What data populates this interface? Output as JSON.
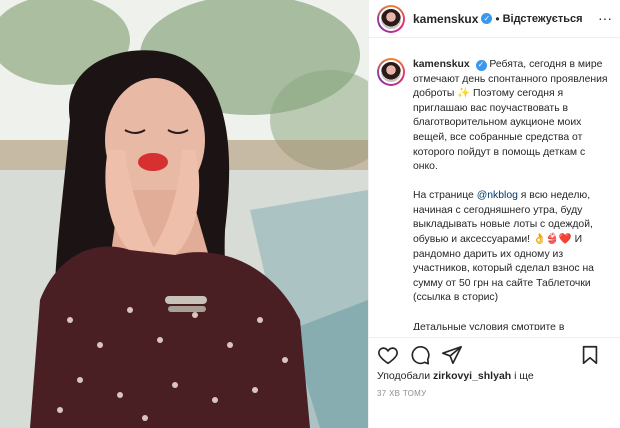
{
  "post": {
    "username": "kamenskux",
    "follow_label": "Відстежується",
    "dot": "•",
    "more": "···",
    "verified": "✓"
  },
  "caption": {
    "username": "kamenskux",
    "p1": "Ребята, сегодня в мире отмечают день спонтанного проявления доброты ✨ Поэтому сегодня я приглашаю вас поучаствовать в благотворительном аукционе моих вещей, все собранные средства от которого пойдут в помощь деткам с онко.",
    "p2_pre": "На странице ",
    "mention": "@nkblog",
    "p2_post": " я всю неделю, начиная с сегодняшнего утра, буду выкладывать новые лоты с одеждой, обувью и аксессуарами! 👌👙❤️ И рандомно дарить их одному из участников, который сделал взнос на сумму от 50 грн на сайте Таблеточки (ссылка в сторис)",
    "p3": "Детальные условия смотрите в"
  },
  "likes": {
    "prefix": "Уподобали ",
    "user": "zirkovyi_shlyah",
    "suffix": " і ще"
  },
  "timestamp": "37 ХВ ТОМУ",
  "icons": {
    "like": "heart-icon",
    "comment": "comment-icon",
    "share": "share-icon",
    "save": "bookmark-icon"
  }
}
